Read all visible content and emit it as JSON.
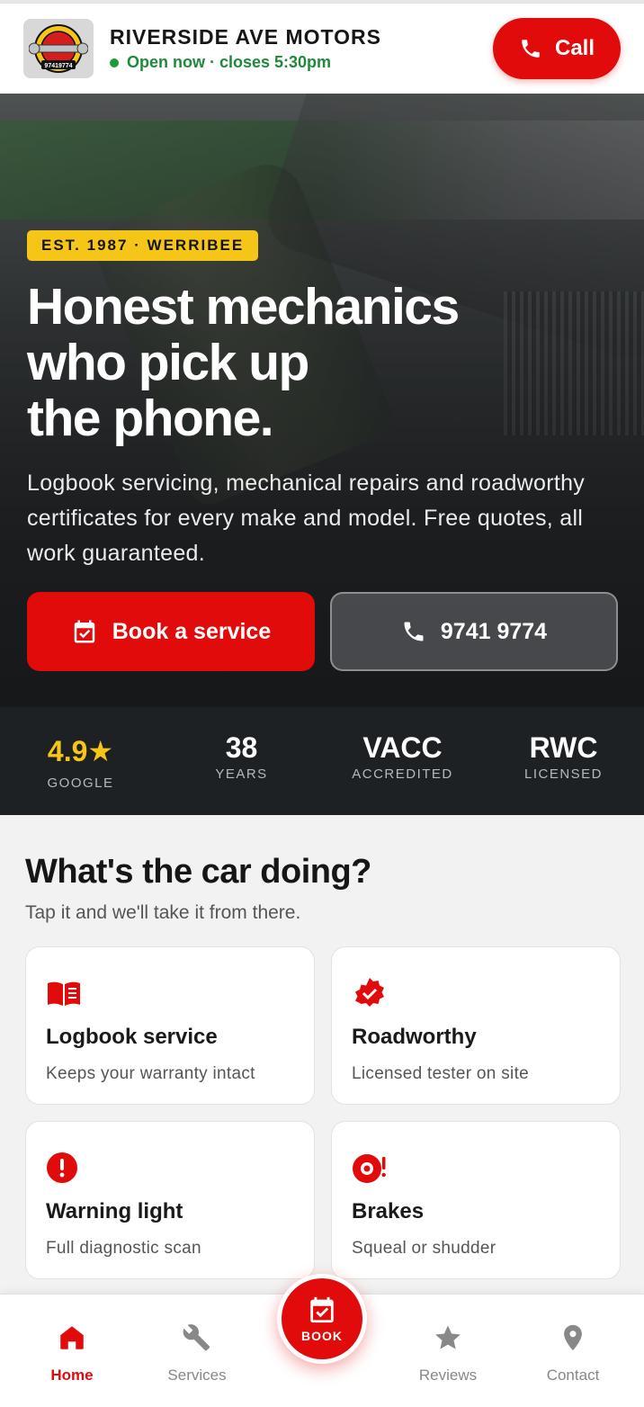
{
  "header": {
    "logo_text": "97419774",
    "business_name": "RIVERSIDE AVE MOTORS",
    "status": "Open now · closes 5:30pm",
    "call_label": "Call"
  },
  "hero": {
    "badge": "EST. 1987 · WERRIBEE",
    "headline": "Honest mechanics\nwho pick up\nthe phone.",
    "subtext": "Logbook servicing, mechanical repairs and roadworthy certificates for every make and model. Free quotes, all work guaranteed.",
    "book_label": "Book a service",
    "phone_label": "9741 9774"
  },
  "stats": [
    {
      "value": "4.9★",
      "label": "GOOGLE"
    },
    {
      "value": "38",
      "label": "YEARS"
    },
    {
      "value": "VACC",
      "label": "ACCREDITED"
    },
    {
      "value": "RWC",
      "label": "LICENSED"
    }
  ],
  "services": {
    "title": "What's the car doing?",
    "subtitle": "Tap it and we'll take it from there.",
    "cards": [
      {
        "icon": "book-icon",
        "title": "Logbook service",
        "subtitle": "Keeps your warranty intact"
      },
      {
        "icon": "verified-badge-icon",
        "title": "Roadworthy",
        "subtitle": "Licensed tester on site"
      },
      {
        "icon": "alert-icon",
        "title": "Warning light",
        "subtitle": "Full diagnostic scan"
      },
      {
        "icon": "brake-disc-icon",
        "title": "Brakes",
        "subtitle": "Squeal or shudder"
      }
    ]
  },
  "nav": {
    "home": "Home",
    "services": "Services",
    "book": "BOOK",
    "reviews": "Reviews",
    "contact": "Contact"
  },
  "colors": {
    "brand_red": "#e10b0b",
    "badge_yellow": "#f5c518",
    "open_green": "#1f8a3b",
    "stats_bg": "#1e2124"
  }
}
